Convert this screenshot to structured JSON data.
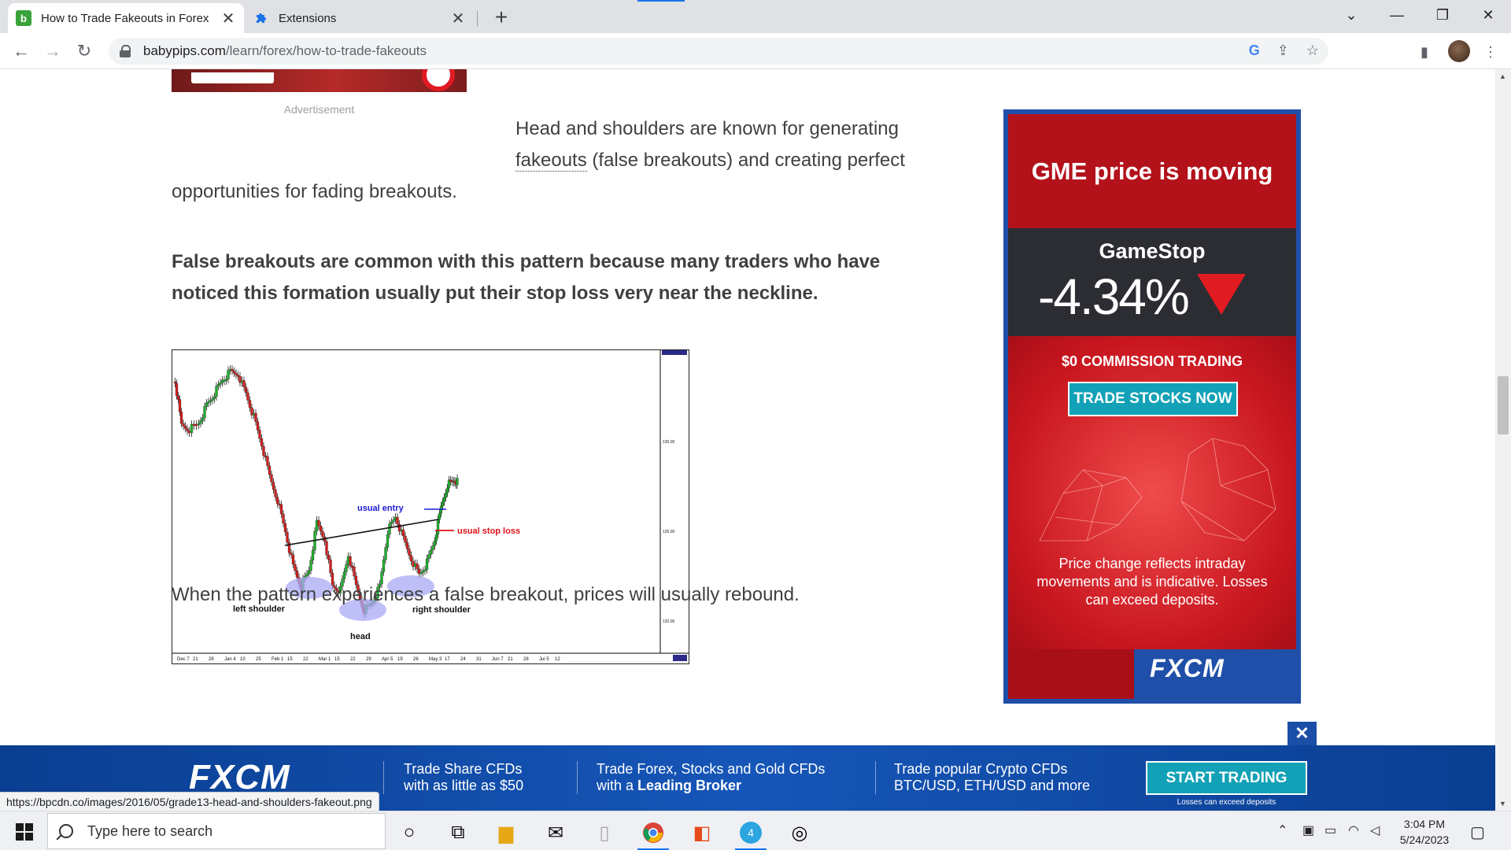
{
  "browser": {
    "tabs": [
      {
        "title": "How to Trade Fakeouts in Forex",
        "favicon": "b",
        "favicon_color": "#3aa23a",
        "active": true
      },
      {
        "title": "Extensions",
        "favicon": "puzzle-icon",
        "favicon_color": "#1a73e8",
        "active": false
      }
    ],
    "tab_close": "✕",
    "new_tab": "+",
    "url_domain": "babypips.com",
    "url_path": "/learn/forex/how-to-trade-fakeouts",
    "status_url": "https://bpcdn.co/images/2016/05/grade13-head-and-shoulders-fakeout.png"
  },
  "article": {
    "ad_label": "Advertisement",
    "p1_a": "Head and shoulders are known for generating",
    "p1_link": "fakeouts",
    "p1_b": " (false breakouts) and creating perfect",
    "p1_c": "opportunities for fading breakouts.",
    "p2_line1": "False breakouts are common with this pattern because many traders who have",
    "p2_line2": "noticed this formation usually put their stop loss very near the neckline.",
    "p3": "When the pattern experiences a false breakout, prices will usually rebound."
  },
  "chart_image": {
    "labels": {
      "usual_entry": "usual entry",
      "usual_stop_loss": "usual stop loss",
      "left_shoulder": "left shoulder",
      "head": "head",
      "right_shoulder": "right shoulder"
    },
    "price_ticks": [
      "130.00",
      "125.00",
      "120.00"
    ],
    "date_ticks": [
      "Dec 7",
      "21",
      "28",
      "Jan 4",
      "10",
      "25",
      "Feb 1",
      "15",
      "22",
      "Mar 1",
      "15",
      "22",
      "29",
      "Apr 5",
      "19",
      "26",
      "May 3",
      "17",
      "24",
      "31",
      "Jun 7",
      "21",
      "28",
      "Jul 5",
      "12"
    ],
    "colors": {
      "entry": "#1a1ad6",
      "stop": "#e0101a",
      "ellipse": "#a9a9f5"
    }
  },
  "side_ad": {
    "headline": "GME price is moving",
    "stock": "GameStop",
    "change": "-4.34%",
    "commission": "$0 COMMISSION TRADING",
    "button": "TRADE STOCKS NOW",
    "disclaimer": "Price change reflects intraday movements and is indicative. Losses can exceed deposits.",
    "logo": "FXCM"
  },
  "bottom_ad": {
    "close": "✕",
    "logo": "FXCM",
    "item1_line1": "Trade Share CFDs",
    "item1_line2": "with as little as $50",
    "item2_line1": "Trade Forex, Stocks and Gold CFDs",
    "item2_line2_a": "with a ",
    "item2_line2_b": "Leading Broker",
    "item3_line1": "Trade popular Crypto CFDs",
    "item3_line2": "BTC/USD, ETH/USD and more",
    "cta": "START TRADING",
    "small": "Losses can exceed deposits"
  },
  "taskbar": {
    "search_placeholder": "Type here to search",
    "time": "3:04 PM",
    "date": "5/24/2023",
    "badge": "4"
  }
}
